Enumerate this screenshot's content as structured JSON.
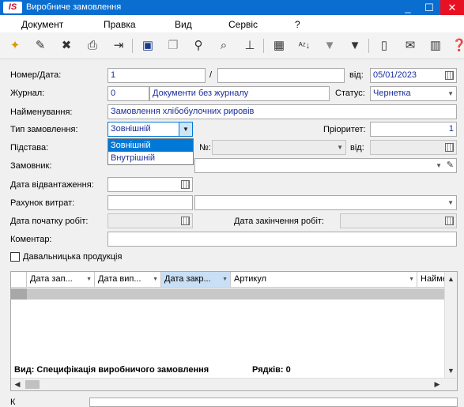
{
  "window": {
    "logo": "IS",
    "title": "Виробниче замовлення",
    "minimize": "_",
    "maximize": "☐",
    "close": "✕"
  },
  "menu": [
    "Документ",
    "Правка",
    "Вид",
    "Сервіс",
    "?"
  ],
  "toolbar_icons": [
    "new-icon",
    "edit-icon",
    "delete-icon",
    "print-icon",
    "export-icon",
    "save-icon",
    "copy-icon",
    "search-icon",
    "find-next-icon",
    "tree-icon",
    "grid-icon",
    "sort-az-icon",
    "filter-icon",
    "clear-filter-icon",
    "details-icon",
    "mail-icon",
    "library-icon",
    "help-icon"
  ],
  "form": {
    "number_date_label": "Номер/Дата:",
    "number_value": "1",
    "slash": "/",
    "suffix_value": "",
    "from_label": "від:",
    "date_value": "05/01/2023",
    "journal_label": "Журнал:",
    "journal_code": "0",
    "journal_name": "Документи без журналу",
    "status_label": "Статус:",
    "status_value": "Чернетка",
    "name_label": "Найменування:",
    "name_value": "Замовлення хлібобулочних рировів",
    "order_type_label": "Тип замовлення:",
    "order_type_value": "Зовнішній",
    "order_type_options": [
      "Зовнішній",
      "Внутрішній"
    ],
    "priority_label": "Пріоритет:",
    "priority_value": "1",
    "basis_label": "Підстава:",
    "basis_no_label": "№:",
    "basis_from_label": "від:",
    "customer_label": "Замовник:",
    "shipment_date_label": "Дата відвантаження:",
    "cost_account_label": "Рахунок витрат:",
    "work_start_label": "Дата початку робіт:",
    "work_end_label": "Дата закінчення робіт:",
    "comment_label": "Коментар:",
    "toll_label": "Давальницька продукція"
  },
  "grid": {
    "columns": [
      "Дата зап...",
      "Дата вип...",
      "Дата закр...",
      "Артикул",
      "Наймє"
    ],
    "view_label": "Вид: Специфікація виробничого замовлення",
    "rows_label": "Рядків: 0"
  },
  "bottom_label": "К"
}
